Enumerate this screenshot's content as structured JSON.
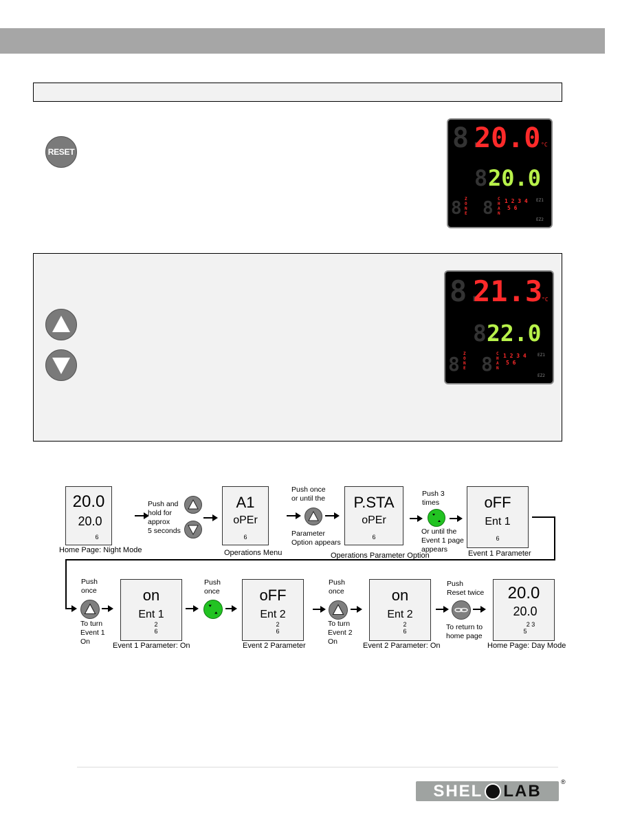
{
  "section1": {
    "reset_button_label": "RESET",
    "display": {
      "top_value": "20.0",
      "top_unit": "°C",
      "bottom_value": "20.0",
      "zone_label": "ZONE",
      "chan_label": "CHAN",
      "indicators_row1": [
        "1",
        "2",
        "3",
        "4"
      ],
      "indicators_row2": [
        "5",
        "6"
      ],
      "ez1": "EZ1",
      "ez2": "EZ2"
    }
  },
  "section2": {
    "display": {
      "top_value": "21.3",
      "top_unit": "°C",
      "bottom_value": "22.0",
      "zone_label": "ZONE",
      "chan_label": "CHAN",
      "indicators_row1": [
        "1",
        "2",
        "3",
        "4"
      ],
      "indicators_row2": [
        "5",
        "6"
      ],
      "ez1": "EZ1",
      "ez2": "EZ2"
    }
  },
  "flow": {
    "row1": {
      "home_night": {
        "line1": "20.0",
        "line2": "20.0",
        "line3": "6",
        "caption": "Home Page: Night Mode"
      },
      "step1_note": [
        "Push and",
        "hold for",
        "approx",
        "5 seconds"
      ],
      "ops_menu": {
        "line1": "A1",
        "line2": "oPEr",
        "line3": "6",
        "caption": "Operations Menu"
      },
      "step2_note_top": [
        "Push once",
        "or until the"
      ],
      "step2_note_bottom": [
        "Parameter",
        "Option appears"
      ],
      "ops_param": {
        "line1": "P.STA",
        "line2": "oPEr",
        "line3": "6",
        "caption": "Operations Parameter Option"
      },
      "step3_note_top": [
        "Push 3",
        "times"
      ],
      "step3_note_bottom": [
        "Or until the",
        "Event 1 page",
        "appears"
      ],
      "event1": {
        "line1": "oFF",
        "line2": "Ent 1",
        "line3": "6",
        "caption": "Event 1 Parameter"
      }
    },
    "row2": {
      "step4_note_top": [
        "Push",
        "once"
      ],
      "step4_note_bottom": [
        "To turn",
        "Event 1",
        "On"
      ],
      "event1_on": {
        "line1": "on",
        "line2": "Ent 1",
        "line3a": "2",
        "line3b": "6",
        "caption": "Event 1 Parameter: On"
      },
      "step5_note_top": [
        "Push",
        "once"
      ],
      "event2": {
        "line1": "oFF",
        "line2": "Ent 2",
        "line3a": "2",
        "line3b": "6",
        "caption": "Event 2 Parameter"
      },
      "step6_note_top": [
        "Push",
        "once"
      ],
      "step6_note_bottom": [
        "To turn",
        "Event 2",
        "On"
      ],
      "event2_on": {
        "line1": "on",
        "line2": "Ent 2",
        "line3a": "2",
        "line3b": "6",
        "caption": "Event 2 Parameter: On"
      },
      "step7_note_top": [
        "Push",
        "Reset twice"
      ],
      "step7_note_bottom": [
        "To return to",
        "home page"
      ],
      "home_day": {
        "line1": "20.0",
        "line2": "20.0",
        "line3a": "2 3",
        "line3b": "5",
        "caption": "Home Page: Day Mode"
      }
    }
  },
  "footer": {
    "logo_left": "SHEL",
    "logo_right": "LAB",
    "registered": "®"
  },
  "colors": {
    "header_gray": "#a6a6a6",
    "panel_bg": "#f2f2f2",
    "lcd_red": "#ff2a2a",
    "lcd_green": "#b8f24a",
    "button_green": "#22c322",
    "button_gray": "#7a7a7a"
  }
}
